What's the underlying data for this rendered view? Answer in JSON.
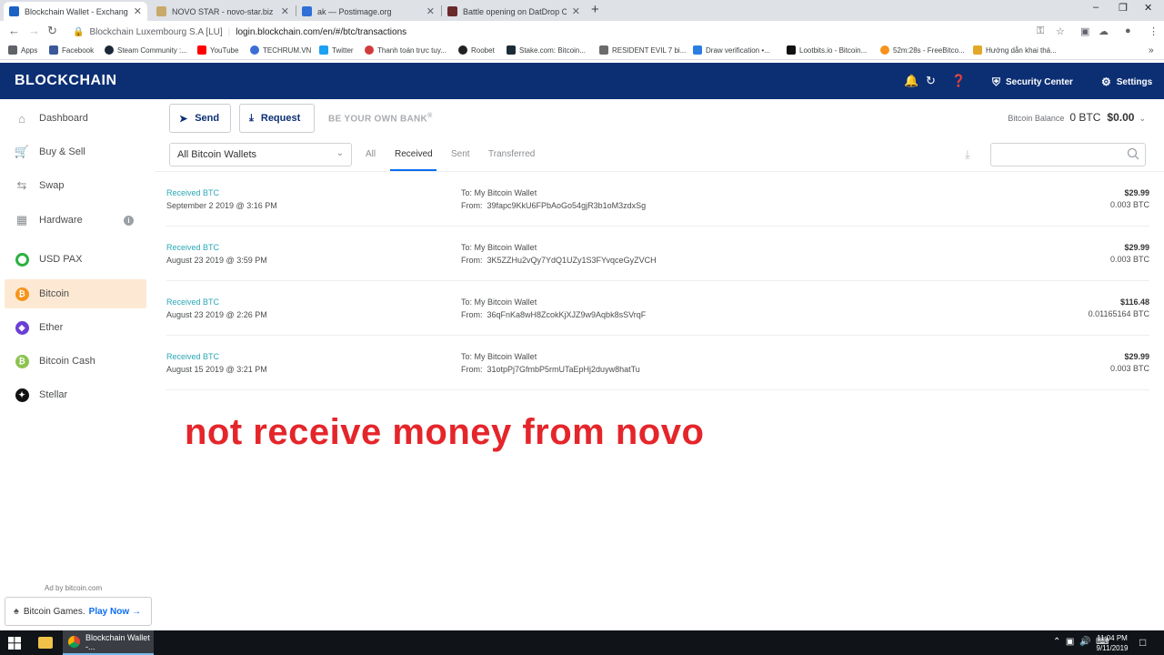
{
  "browser": {
    "tabs": [
      {
        "title": "Blockchain Wallet - Exchange Cry",
        "active": true,
        "favicon_color": "#1a63c5"
      },
      {
        "title": "NOVO STAR - novo-star.biz - tra",
        "active": false,
        "favicon_color": "#c8a96a"
      },
      {
        "title": "ak — Postimage.org",
        "active": false,
        "favicon_color": "#2f6fd6"
      },
      {
        "title": "Battle opening on DatDrop CS:G",
        "active": false,
        "favicon_color": "#6a2a2a"
      }
    ],
    "close_glyph": "✕",
    "new_tab_glyph": "+",
    "address": {
      "org": "Blockchain Luxembourg S.A [LU]",
      "url": "login.blockchain.com/en/#/btc/transactions"
    },
    "bookmarks": [
      {
        "label": "Apps",
        "color": "#5f6368"
      },
      {
        "label": "Facebook",
        "color": "#3b5998"
      },
      {
        "label": "Steam Community :...",
        "color": "#1b2838"
      },
      {
        "label": "YouTube",
        "color": "#ff0000"
      },
      {
        "label": "TECHRUM.VN",
        "color": "#3b6fd6"
      },
      {
        "label": "Twitter",
        "color": "#1da1f2"
      },
      {
        "label": "Thanh toán trực tuy...",
        "color": "#d23b3b"
      },
      {
        "label": "Roobet",
        "color": "#222222"
      },
      {
        "label": "Stake.com: Bitcoin...",
        "color": "#1a2c38"
      },
      {
        "label": "RESIDENT EVIL 7 bi...",
        "color": "#6b6b6b"
      },
      {
        "label": "Draw verification •...",
        "color": "#2a7de1"
      },
      {
        "label": "Lootbits.io - Bitcoin...",
        "color": "#111111"
      },
      {
        "label": "52m:28s - FreeBitco...",
        "color": "#f7931a"
      },
      {
        "label": "Hướng dẫn khai thá...",
        "color": "#e2a829"
      }
    ]
  },
  "header": {
    "logo": "BLOCKCHAIN",
    "security_center": "Security Center",
    "settings": "Settings"
  },
  "sidebar": {
    "items": [
      {
        "label": "Dashboard",
        "icon": "home-icon"
      },
      {
        "label": "Buy & Sell",
        "icon": "cart-icon"
      },
      {
        "label": "Swap",
        "icon": "swap-icon"
      },
      {
        "label": "Hardware",
        "icon": "hardware-icon"
      },
      {
        "label": "USD PAX",
        "icon": "usd-pax-icon",
        "color": "#2bb13f"
      },
      {
        "label": "Bitcoin",
        "icon": "bitcoin-icon",
        "color": "#f7931a",
        "active": true
      },
      {
        "label": "Ether",
        "icon": "ether-icon",
        "color": "#6b3fd4"
      },
      {
        "label": "Bitcoin Cash",
        "icon": "bitcoin-cash-icon",
        "color": "#8dc351"
      },
      {
        "label": "Stellar",
        "icon": "stellar-icon",
        "color": "#111111"
      }
    ],
    "ad_label": "Ad by bitcoin.com",
    "ad_text": "Bitcoin Games.",
    "ad_cta": "Play Now"
  },
  "toolbar": {
    "send": "Send",
    "request": "Request",
    "slogan": "BE YOUR OWN BANK",
    "slogan_mark": "®",
    "balance_label": "Bitcoin Balance",
    "balance_btc": "0 BTC",
    "balance_usd": "$0.00"
  },
  "filters": {
    "wallet_select": "All Bitcoin Wallets",
    "tabs": [
      "All",
      "Received",
      "Sent",
      "Transferred"
    ],
    "active_tab": "Received"
  },
  "transactions": [
    {
      "type": "Received BTC",
      "date": "September 2 2019 @ 3:16 PM",
      "to": "To: My Bitcoin Wallet",
      "from_label": "From:",
      "from": "39fapc9KkU6FPbAoGo54gjR3b1oM3zdxSg",
      "fiat": "$29.99",
      "btc": "0.003 BTC"
    },
    {
      "type": "Received BTC",
      "date": "August 23 2019 @ 3:59 PM",
      "to": "To: My Bitcoin Wallet",
      "from_label": "From:",
      "from": "3K5ZZHu2vQy7YdQ1UZy1S3FYvqceGyZVCH",
      "fiat": "$29.99",
      "btc": "0.003 BTC"
    },
    {
      "type": "Received BTC",
      "date": "August 23 2019 @ 2:26 PM",
      "to": "To: My Bitcoin Wallet",
      "from_label": "From:",
      "from": "36qFnKa8wH8ZcokKjXJZ9w9Aqbk8sSVrqF",
      "fiat": "$116.48",
      "btc": "0.01165164 BTC"
    },
    {
      "type": "Received BTC",
      "date": "August 15 2019 @ 3:21 PM",
      "to": "To: My Bitcoin Wallet",
      "from_label": "From:",
      "from": "31otpPj7GfmbP5rmUTaEpHj2duyw8hatTu",
      "fiat": "$29.99",
      "btc": "0.003 BTC"
    }
  ],
  "annotation": "not receive money from novo",
  "taskbar": {
    "app": "Blockchain Wallet -...",
    "time": "11:04 PM",
    "date": "9/11/2019"
  }
}
